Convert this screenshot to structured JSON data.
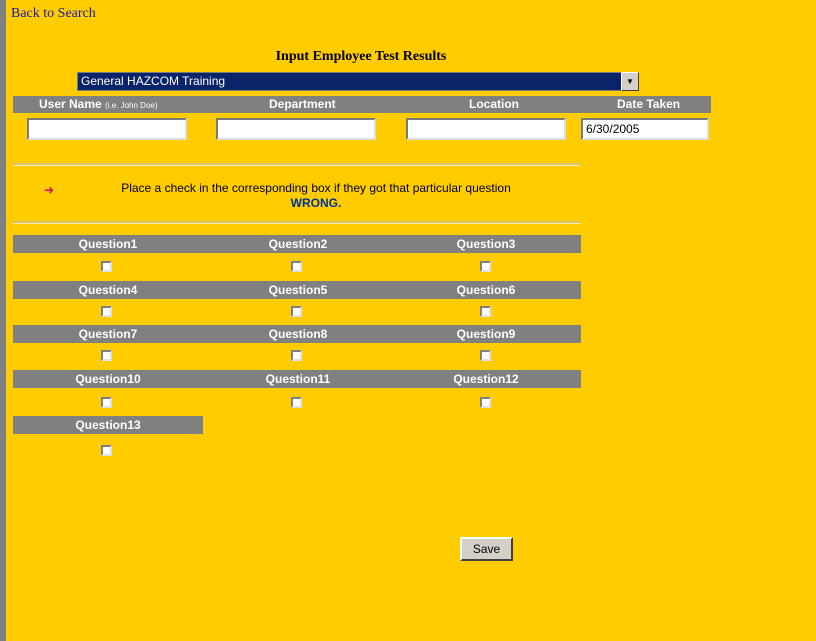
{
  "nav": {
    "back_label": "Back to Search"
  },
  "page": {
    "title": "Input Employee Test Results"
  },
  "training_select": {
    "selected": "General HAZCOM Training"
  },
  "fields": {
    "user_name_label": "User Name",
    "user_name_hint": "(i.e. John Doe)",
    "department_label": "Department",
    "location_label": "Location",
    "date_label": "Date Taken",
    "user_name_value": "",
    "department_value": "",
    "location_value": "",
    "date_value": "6/30/2005"
  },
  "instructions": {
    "text": "Place a check in the corresponding box if they got that particular question",
    "emphasis": "WRONG."
  },
  "questions": [
    {
      "label": "Question1",
      "checked": false
    },
    {
      "label": "Question2",
      "checked": false
    },
    {
      "label": "Question3",
      "checked": false
    },
    {
      "label": "Question4",
      "checked": false
    },
    {
      "label": "Question5",
      "checked": false
    },
    {
      "label": "Question6",
      "checked": false
    },
    {
      "label": "Question7",
      "checked": false
    },
    {
      "label": "Question8",
      "checked": false
    },
    {
      "label": "Question9",
      "checked": false
    },
    {
      "label": "Question10",
      "checked": false
    },
    {
      "label": "Question11",
      "checked": false
    },
    {
      "label": "Question12",
      "checked": false
    },
    {
      "label": "Question13",
      "checked": false
    }
  ],
  "actions": {
    "save_label": "Save"
  },
  "colors": {
    "background": "#ffcc00",
    "header_bar": "#808080",
    "select_bg": "#0a246a",
    "link": "#1a1aa6",
    "bullet": "#e0006e",
    "emphasis": "#003399"
  }
}
